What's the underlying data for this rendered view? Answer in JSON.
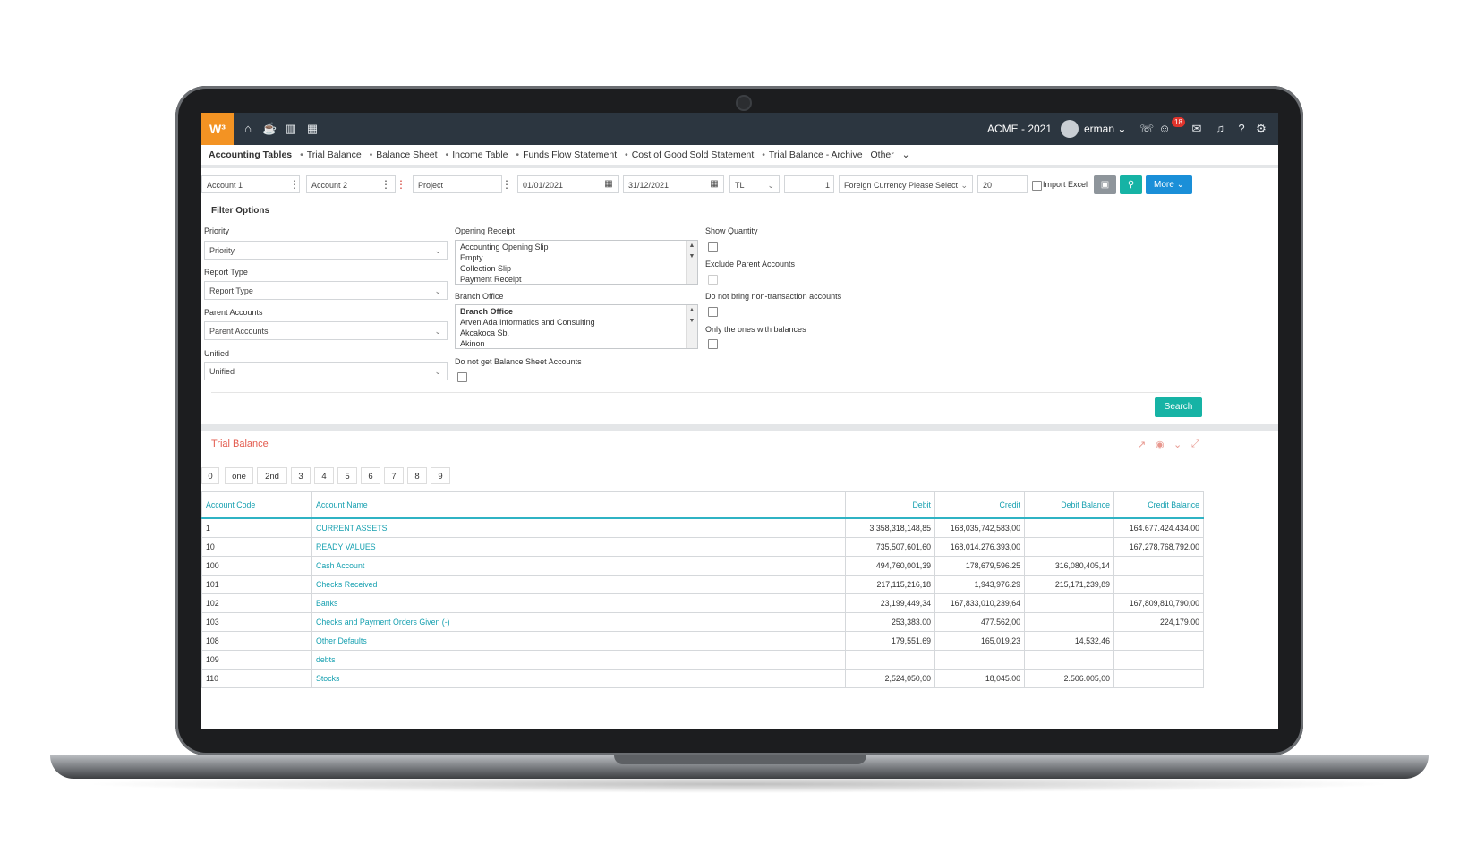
{
  "app": {
    "logo": "W³",
    "company": "ACME - 2021",
    "user": "erman",
    "notifications": "18"
  },
  "breadcrumb": {
    "title": "Accounting Tables",
    "items": [
      "Trial Balance",
      "Balance Sheet",
      "Income Table",
      "Funds Flow Statement",
      "Cost of Good Sold Statement",
      "Trial Balance - Archive"
    ],
    "other": "Other"
  },
  "filters": {
    "account1": "Account 1",
    "account2": "Account 2",
    "project": "Project",
    "date_from": "01/01/2021",
    "date_to": "31/12/2021",
    "currency": "TL",
    "rate": "1",
    "foreign_currency": "Foreign Currency Please Select",
    "limit": "20",
    "import_excel": "Import Excel",
    "more": "More"
  },
  "filter_options": {
    "heading": "Filter Options",
    "priority_label": "Priority",
    "priority_value": "Priority",
    "report_type_label": "Report Type",
    "report_type_value": "Report Type",
    "parent_accounts_label": "Parent Accounts",
    "parent_accounts_value": "Parent Accounts",
    "unified_label": "Unified",
    "unified_value": "Unified",
    "opening_receipt_label": "Opening Receipt",
    "opening_receipt_options": [
      "Accounting Opening Slip",
      "Empty",
      "Collection Slip",
      "Payment Receipt"
    ],
    "branch_office_label": "Branch Office",
    "branch_office_options": [
      "Branch Office",
      "Arven Ada Informatics and Consulting",
      "Akcakoca Sb.",
      "Akinon"
    ],
    "no_balance_sheet_label": "Do not get Balance Sheet Accounts",
    "show_quantity_label": "Show Quantity",
    "exclude_parent_label": "Exclude Parent Accounts",
    "no_nontransaction_label": "Do not bring non-transaction accounts",
    "only_balances_label": "Only the ones with balances",
    "search": "Search"
  },
  "panel": {
    "title": "Trial Balance",
    "levels": [
      "0",
      "one",
      "2nd",
      "3",
      "4",
      "5",
      "6",
      "7",
      "8",
      "9"
    ]
  },
  "table": {
    "headers": [
      "Account Code",
      "Account Name",
      "Debit",
      "Credit",
      "Debit Balance",
      "Credit Balance"
    ],
    "rows": [
      [
        "1",
        "CURRENT ASSETS",
        "3,358,318,148,85",
        "168,035,742,583,00",
        "",
        "164.677.424.434.00"
      ],
      [
        "10",
        "READY VALUES",
        "735,507,601,60",
        "168,014.276.393,00",
        "",
        "167,278,768,792.00"
      ],
      [
        "100",
        "Cash Account",
        "494,760,001,39",
        "178,679,596.25",
        "316,080,405,14",
        ""
      ],
      [
        "101",
        "Checks Received",
        "217,115,216,18",
        "1,943,976.29",
        "215,171,239,89",
        ""
      ],
      [
        "102",
        "Banks",
        "23,199,449,34",
        "167,833,010,239,64",
        "",
        "167,809,810,790,00"
      ],
      [
        "103",
        "Checks and Payment Orders Given (-)",
        "253,383.00",
        "477.562,00",
        "",
        "224,179.00"
      ],
      [
        "108",
        "Other Defaults",
        "179,551.69",
        "165,019,23",
        "14,532,46",
        ""
      ],
      [
        "109",
        "debts",
        "",
        "",
        "",
        ""
      ],
      [
        "110",
        "Stocks",
        "2,524,050,00",
        "18,045.00",
        "2.506.005,00",
        ""
      ]
    ]
  },
  "colors": {
    "topbar": "#2c3640",
    "logo": "#f39323",
    "accent": "#16b3a5",
    "more": "#1a8fd8",
    "link": "#16a0b0",
    "panel_title": "#e35b4e"
  }
}
